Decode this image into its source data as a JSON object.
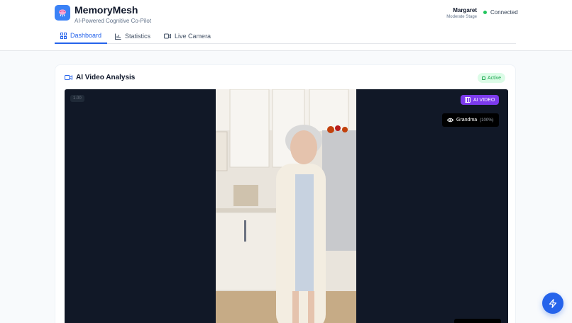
{
  "app": {
    "title": "MemoryMesh",
    "subtitle": "AI-Powered Cognitive Co-Pilot"
  },
  "user": {
    "name": "Margaret",
    "stage": "Moderate Stage"
  },
  "connection": {
    "status": "Connected",
    "color": "#22c55e"
  },
  "tabs": [
    {
      "label": "Dashboard",
      "icon": "grid-icon",
      "active": true
    },
    {
      "label": "Statistics",
      "icon": "bar-chart-icon",
      "active": false
    },
    {
      "label": "Live Camera",
      "icon": "video-icon",
      "active": false
    }
  ],
  "card": {
    "title": "AI Video Analysis",
    "status": "Active"
  },
  "video": {
    "speed": "1.00",
    "ai_badge": "AI VIDEO",
    "detection": {
      "name": "Grandma",
      "confidence": "(100%)"
    }
  },
  "colors": {
    "accent": "#2563eb",
    "ai": "#7c3aed",
    "active_bg": "#dcfce7",
    "active_text": "#16a34a"
  }
}
